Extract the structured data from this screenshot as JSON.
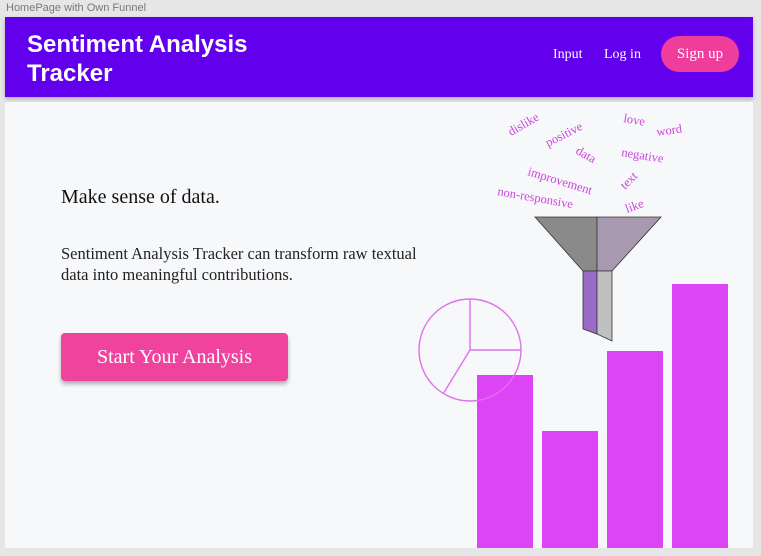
{
  "window": {
    "frame_label": "HomePage with Own Funnel"
  },
  "header": {
    "title": "Sentiment Analysis Tracker",
    "nav": {
      "input_label": "Input",
      "login_label": "Log in",
      "signup_label": "Sign up"
    }
  },
  "hero": {
    "headline": "Make sense of data.",
    "description": "Sentiment Analysis Tracker can transform raw textual data into meaningful contributions.",
    "cta_label": "Start Your Analysis"
  },
  "illustration": {
    "words": [
      "dislike",
      "positive",
      "love",
      "word",
      "data",
      "negative",
      "improvement",
      "text",
      "non-responsive",
      "like"
    ],
    "bar_count": 4
  },
  "colors": {
    "header_bg": "#6200ee",
    "accent_pink": "#f0439e",
    "bar_magenta": "#dd44f5",
    "word_color": "#cc44dd"
  },
  "icons": {
    "funnel": "funnel-icon",
    "pie": "pie-chart-icon"
  }
}
